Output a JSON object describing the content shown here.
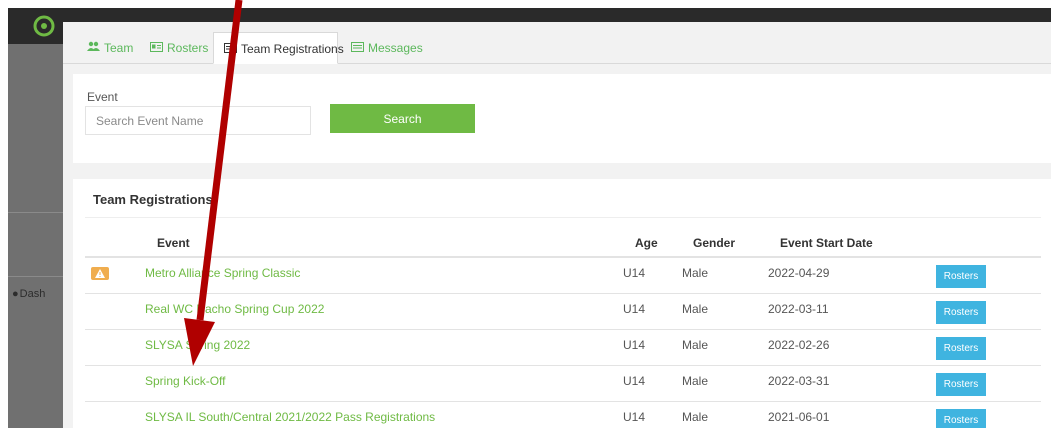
{
  "background": {
    "dashboard_label": "Dash"
  },
  "tabs": [
    {
      "label": "Team",
      "icon": "users-icon"
    },
    {
      "label": "Rosters",
      "icon": "id-card-icon"
    },
    {
      "label": "Team Registrations",
      "icon": "list-icon",
      "active": true
    },
    {
      "label": "Messages",
      "icon": "list-icon"
    }
  ],
  "search": {
    "label": "Event",
    "placeholder": "Search Event Name",
    "value": "",
    "button_label": "Search"
  },
  "registrations": {
    "title": "Team Registrations",
    "columns": [
      "Event",
      "Age",
      "Gender",
      "Event Start Date"
    ],
    "rows": [
      {
        "event": "Metro Alliance Spring Classic",
        "age": "U14",
        "gender": "Male",
        "date": "2022-04-29",
        "action": "Rosters",
        "warning": true
      },
      {
        "event": "Real WC Nacho Spring Cup 2022",
        "age": "U14",
        "gender": "Male",
        "date": "2022-03-11",
        "action": "Rosters"
      },
      {
        "event": "SLYSA Spring 2022",
        "age": "U14",
        "gender": "Male",
        "date": "2022-02-26",
        "action": "Rosters"
      },
      {
        "event": "Spring Kick-Off",
        "age": "U14",
        "gender": "Male",
        "date": "2022-03-31",
        "action": "Rosters"
      },
      {
        "event": "SLYSA IL South/Central 2021/2022 Pass Registrations",
        "age": "U14",
        "gender": "Male",
        "date": "2021-06-01",
        "action": "Rosters"
      }
    ]
  },
  "colors": {
    "accent_green": "#6fba44",
    "rosters_blue": "#3fb4e0",
    "warning_orange": "#f0ad4e",
    "annotation_arrow": "#b00000"
  }
}
